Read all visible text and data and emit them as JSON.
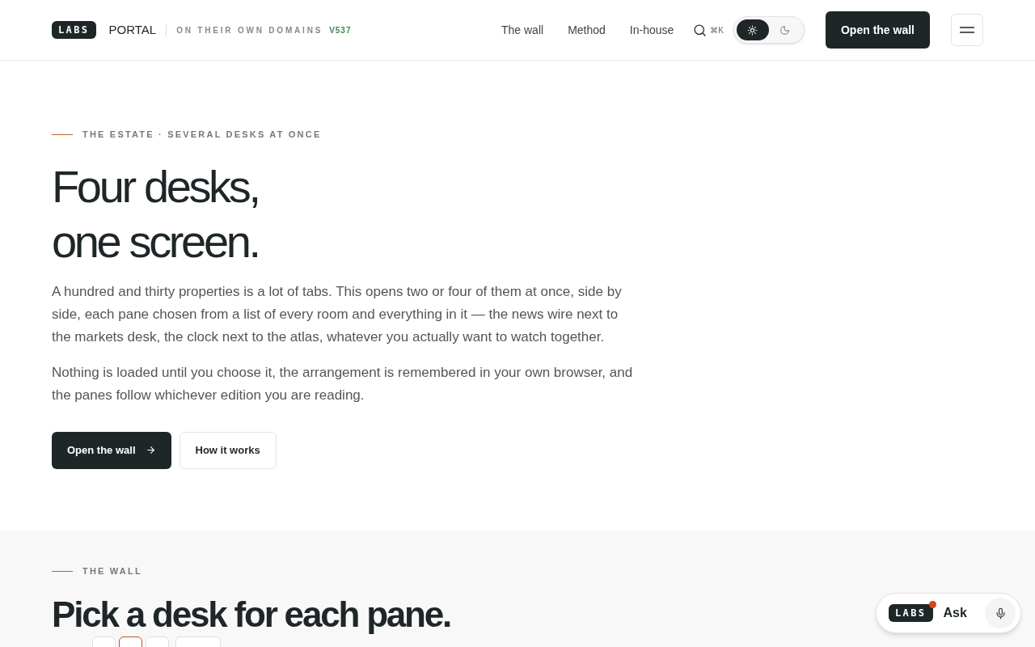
{
  "header": {
    "logo": "LABS",
    "brand": "PORTAL",
    "tagline": "ON THEIR OWN DOMAINS",
    "version": "V537",
    "nav": [
      {
        "label": "The wall"
      },
      {
        "label": "Method"
      },
      {
        "label": "In-house"
      }
    ],
    "search_shortcut": "⌘K",
    "theme": [
      {
        "kind": "light",
        "selected": true
      },
      {
        "kind": "dark",
        "selected": false
      }
    ],
    "cta": "Open the wall"
  },
  "hero": {
    "eyebrow": "THE ESTATE · SEVERAL DESKS AT ONCE",
    "title_lines": [
      "Four desks,",
      "one screen."
    ],
    "paragraphs": [
      "A hundred and thirty properties is a lot of tabs. This opens two or four of them at once, side by side, each pane chosen from a list of every room and everything in it — the news wire next to the markets desk, the clock next to the atlas, whatever you actually want to watch together.",
      "Nothing is loaded until you choose it, the arrangement is remembered in your own browser, and the panes follow whichever edition you are reading."
    ],
    "primary": "Open the wall",
    "secondary": "How it works"
  },
  "wall": {
    "eyebrow": "THE WALL",
    "title": "Pick a desk for each pane.",
    "pane_options": [
      {
        "selected": false
      },
      {
        "selected": true
      },
      {
        "selected": false
      }
    ]
  },
  "assistant": {
    "logo": "LABS",
    "label": "Ask",
    "notification": true
  }
}
